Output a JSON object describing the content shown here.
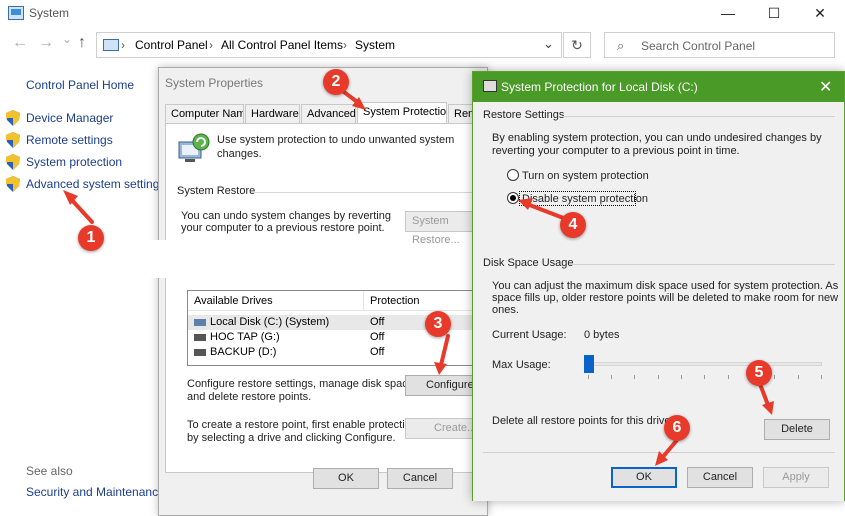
{
  "window": {
    "title": "System",
    "minimize": "—",
    "maximize": "☐",
    "close": "✕"
  },
  "address": {
    "back": "←",
    "forward": "→",
    "dropdown": "⌄",
    "up": "↑",
    "crumbs": [
      "Control Panel",
      "All Control Panel Items",
      "System"
    ],
    "separator": "›",
    "refresh": "↻",
    "search_placeholder": "Search Control Panel"
  },
  "sidebar": {
    "home": "Control Panel Home",
    "links": [
      "Device Manager",
      "Remote settings",
      "System protection",
      "Advanced system settings"
    ],
    "see_also": "See also",
    "security_maintenance": "Security and Maintenance"
  },
  "system_properties": {
    "title": "System Properties",
    "tabs": [
      "Computer Name",
      "Hardware",
      "Advanced",
      "System Protection",
      "Remote"
    ],
    "active_tab": "System Protection",
    "intro": "Use system protection to undo unwanted system changes.",
    "restore_heading": "System Restore",
    "restore_desc_1": "You can undo system changes by reverting",
    "restore_desc_2": "your computer to a previous restore point.",
    "system_restore_button": "System Restore...",
    "table_headers": [
      "Available Drives",
      "Protection"
    ],
    "drives": [
      {
        "name": "Local Disk (C:) (System)",
        "protection": "Off"
      },
      {
        "name": "HOC TAP (G:)",
        "protection": "Off"
      },
      {
        "name": "BACKUP (D:)",
        "protection": "Off"
      }
    ],
    "configure_desc_1": "Configure restore settings, manage disk space,",
    "configure_desc_2": "and delete restore points.",
    "configure_button": "Configure...",
    "create_desc_1": "To create a restore point, first enable protection",
    "create_desc_2": "by selecting a drive and clicking Configure.",
    "create_button": "Create...",
    "ok": "OK",
    "cancel": "Cancel"
  },
  "protection_dialog": {
    "title": "System Protection for Local Disk (C:)",
    "close": "✕",
    "restore_settings_heading": "Restore Settings",
    "restore_desc_1": "By enabling system protection, you can undo undesired changes by",
    "restore_desc_2": "reverting your computer to a previous point in time.",
    "option_on": "Turn on system protection",
    "option_off": "Disable system protection",
    "selected_option": "Disable system protection",
    "disk_heading": "Disk Space Usage",
    "disk_desc_1": "You can adjust the maximum disk space used for system protection. As",
    "disk_desc_2": "space fills up, older restore points will be deleted to make room for new",
    "disk_desc_3": "ones.",
    "current_usage_label": "Current Usage:",
    "current_usage_value": "0 bytes",
    "max_usage_label": "Max Usage:",
    "max_usage_fraction": 0.0,
    "delete_desc": "Delete all restore points for this drive.",
    "delete_button": "Delete",
    "ok": "OK",
    "cancel": "Cancel",
    "apply": "Apply"
  },
  "callouts": [
    "1",
    "2",
    "3",
    "4",
    "5",
    "6"
  ],
  "colors": {
    "callout": "#e83a2a",
    "title_bar": "#4a9a27",
    "link": "#1a3e8c",
    "slider": "#0b62c8"
  }
}
